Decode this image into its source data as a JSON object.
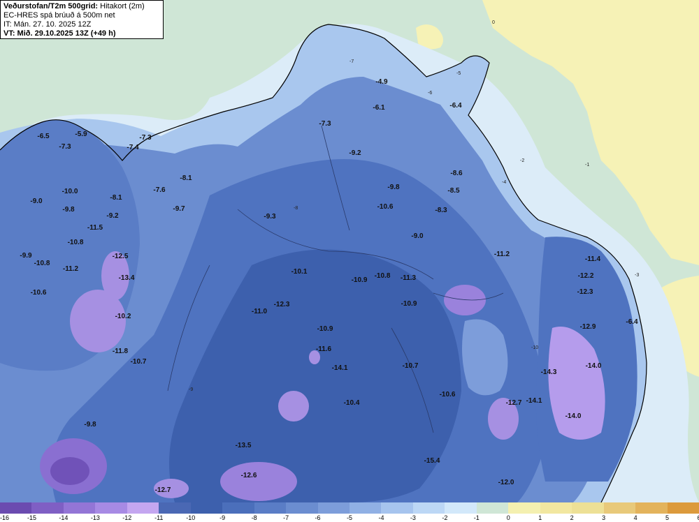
{
  "header": {
    "title": "Veðurstofan/T2m 500grid:",
    "title_suffix": "Hitakort (2m)",
    "line2": "EC-HRES spá brúuð á 500m net",
    "line3": "IT: Mán. 27. 10. 2025 12Z",
    "line4": "VT: Mið. 29.10.2025 13Z (+49 h)"
  },
  "legend": {
    "labels": [
      "-16",
      "-15",
      "-14",
      "-13",
      "-12",
      "-11",
      "-10",
      "-9",
      "-8",
      "-7",
      "-6",
      "-5",
      "-4",
      "-3",
      "-2",
      "-1",
      "0",
      "1",
      "2",
      "3",
      "4",
      "5",
      "6"
    ],
    "colors": [
      "#6b4bb0",
      "#7f5fc4",
      "#9375d6",
      "#a78ae4",
      "#c4a6f0",
      "#4a68b4",
      "#3d60ad",
      "#4b6fbb",
      "#5a7dc6",
      "#6b8dd0",
      "#7d9dda",
      "#90b0e4",
      "#a6c4ee",
      "#bcd7f5",
      "#d2e8fa",
      "#cfe6d6",
      "#f4f0b0",
      "#f2e7a0",
      "#ede096",
      "#e8c97a",
      "#e3b35c",
      "#dc9a3c"
    ]
  },
  "map_labels": [
    {
      "text": "-6.5"
    },
    {
      "text": "-7.3"
    },
    {
      "text": "-5.9"
    },
    {
      "text": "-7.3"
    },
    {
      "text": "-7.4"
    },
    {
      "text": "-7.6"
    },
    {
      "text": "-8.1"
    },
    {
      "text": "-9.7"
    },
    {
      "text": "-10.0"
    },
    {
      "text": "-9.0"
    },
    {
      "text": "-9.8"
    },
    {
      "text": "-8.1"
    },
    {
      "text": "-9.2"
    },
    {
      "text": "-11.5"
    },
    {
      "text": "-10.8"
    },
    {
      "text": "-9.9"
    },
    {
      "text": "-10.8"
    },
    {
      "text": "-11.2"
    },
    {
      "text": "-12.5"
    },
    {
      "text": "-13.4"
    },
    {
      "text": "-10.6"
    },
    {
      "text": "-10.2"
    },
    {
      "text": "-11.8"
    },
    {
      "text": "-10.7"
    },
    {
      "text": "-9.3"
    },
    {
      "text": "-7.3"
    },
    {
      "text": "-4.9"
    },
    {
      "text": "-6.1"
    },
    {
      "text": "-6.4"
    },
    {
      "text": "-9.2"
    },
    {
      "text": "-9.8"
    },
    {
      "text": "-8.6"
    },
    {
      "text": "-8.5"
    },
    {
      "text": "-10.6"
    },
    {
      "text": "-8.3"
    },
    {
      "text": "-9.0"
    },
    {
      "text": "-10.1"
    },
    {
      "text": "-10.9"
    },
    {
      "text": "-10.8"
    },
    {
      "text": "-11.3"
    },
    {
      "text": "-12.3"
    },
    {
      "text": "-11.0"
    },
    {
      "text": "-10.9"
    },
    {
      "text": "-11.6"
    },
    {
      "text": "-14.1"
    },
    {
      "text": "-10.7"
    },
    {
      "text": "-10.6"
    },
    {
      "text": "-10.4"
    },
    {
      "text": "-11.2"
    },
    {
      "text": "-11.4"
    },
    {
      "text": "-12.2"
    },
    {
      "text": "-12.3"
    },
    {
      "text": "-12.9"
    },
    {
      "text": "-6.4"
    },
    {
      "text": "-14.0"
    },
    {
      "text": "-14.3"
    },
    {
      "text": "-14.1"
    },
    {
      "text": "-14.0"
    },
    {
      "text": "-12.7"
    },
    {
      "text": "-9.8"
    },
    {
      "text": "-13.5"
    },
    {
      "text": "-12.6"
    },
    {
      "text": "-12.7"
    },
    {
      "text": "-15.4"
    },
    {
      "text": "-12.0"
    },
    {
      "text": "-10.9"
    }
  ],
  "isoline_labels": [
    "0",
    "-1",
    "-2",
    "-3",
    "-4",
    "-5",
    "-6",
    "-7",
    "-8",
    "-9",
    "-10"
  ]
}
